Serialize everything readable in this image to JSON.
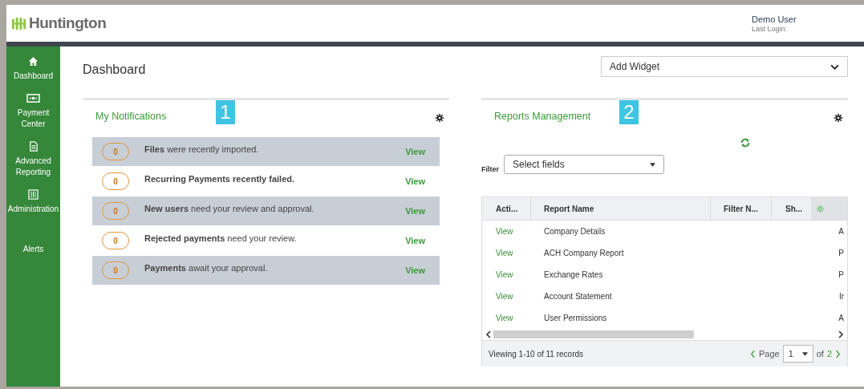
{
  "header": {
    "logo": "Huntington",
    "user": "Demo User",
    "last_login": "Last Login:"
  },
  "sidebar": {
    "items": [
      {
        "label": "Dashboard"
      },
      {
        "label": "Payment Center"
      },
      {
        "label": "Advanced Reporting"
      },
      {
        "label": "Administration"
      },
      {
        "label": "Alerts"
      }
    ]
  },
  "page": {
    "title": "Dashboard",
    "add_widget": "Add Widget"
  },
  "notifications": {
    "title": "My Notifications",
    "callout": "1",
    "items": [
      {
        "count": "0",
        "text": "**Files** were recently imported.",
        "action": "View"
      },
      {
        "count": "0",
        "text": "**Recurring Payments recently failed.**",
        "action": "View"
      },
      {
        "count": "0",
        "text": "**New users** need your review and approval.",
        "action": "View"
      },
      {
        "count": "0",
        "text": "**Rejected payments** need your review.",
        "action": "View"
      },
      {
        "count": "0",
        "text": "**Payments** await your approval.",
        "action": "View"
      }
    ]
  },
  "reports": {
    "title": "Reports Management",
    "callout": "2",
    "filter_label": "Filter",
    "filter_placeholder": "Select fields",
    "columns": [
      "Acti...",
      "Report Name",
      "Filter N...",
      "Sh..."
    ],
    "rows": [
      {
        "action": "View",
        "name": "Company Details",
        "column_5": "A"
      },
      {
        "action": "View",
        "name": "ACH Company Report",
        "column_5": "P"
      },
      {
        "action": "View",
        "name": "Exchange Rates",
        "column_5": "P"
      },
      {
        "action": "View",
        "name": "Account Statement",
        "column_5": "Ir"
      },
      {
        "action": "View",
        "name": "User Permissions",
        "column_5": "A"
      }
    ],
    "footer": {
      "viewing": "Viewing 1-10 of 11 records",
      "page_label": "Page",
      "page": "1",
      "of": "of",
      "total": "2"
    }
  }
}
